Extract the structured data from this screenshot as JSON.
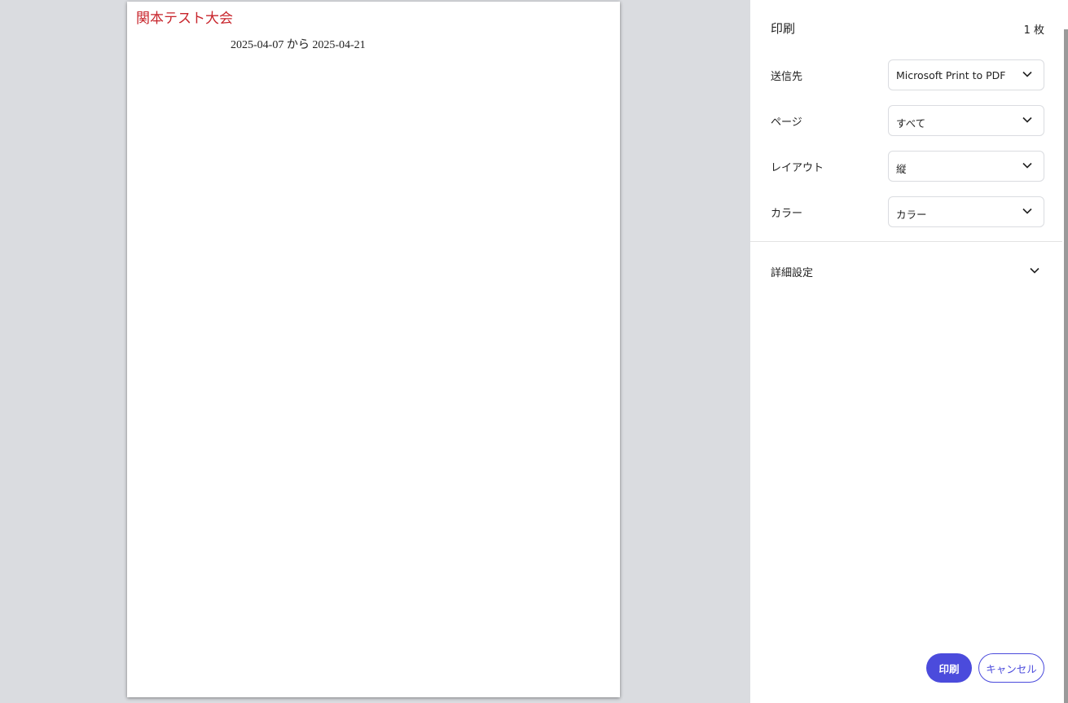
{
  "preview": {
    "title": "関本テスト大会",
    "date_range": "2025-04-07 から 2025-04-21"
  },
  "panel": {
    "title": "印刷",
    "sheet_count": "1 枚",
    "settings": [
      {
        "label": "送信先",
        "value": "Microsoft Print to PDF"
      },
      {
        "label": "ページ",
        "value": "すべて"
      },
      {
        "label": "レイアウト",
        "value": "縦"
      },
      {
        "label": "カラー",
        "value": "カラー"
      }
    ],
    "details_label": "詳細設定",
    "print_button": "印刷",
    "cancel_button": "キャンセル"
  },
  "colors": {
    "accent": "#4b4bdc",
    "title_red": "#c8252c"
  },
  "icons": {
    "select_arrow": "chevron-down-icon",
    "details_arrow": "chevron-down-icon"
  }
}
